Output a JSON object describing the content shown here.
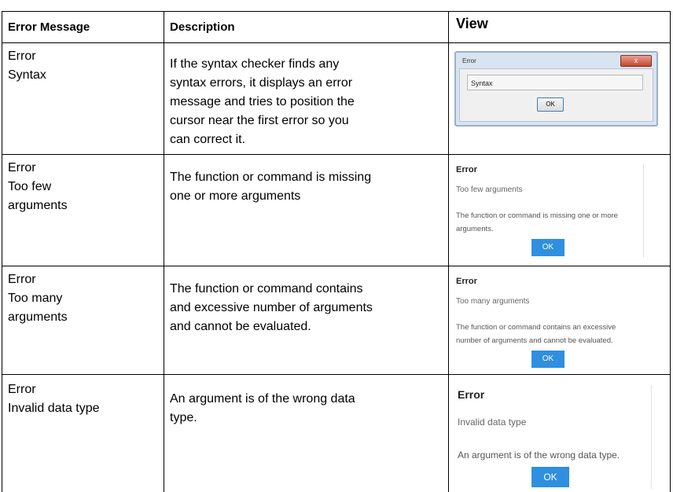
{
  "headers": {
    "col1": "Error Message",
    "col2": "Description",
    "col3": "View"
  },
  "rows": [
    {
      "message_line1": "Error",
      "message_line2": "Syntax",
      "description": "If the syntax checker finds any\nsyntax errors, it displays an error\nmessage and tries to position the\ncursor near the first error so you\ncan correct it.",
      "view": {
        "title": "Error",
        "close": "x",
        "field": "Syntax",
        "ok": "OK"
      }
    },
    {
      "message_line1": "Error",
      "message_line2": "Too few\narguments",
      "description": "The function or command is missing\none or more arguments",
      "view": {
        "title": "Error",
        "subtitle": "Too few arguments",
        "text": "The function or command is missing one or more\narguments.",
        "ok": "OK"
      }
    },
    {
      "message_line1": "Error",
      "message_line2": "Too many\narguments",
      "description": "The function or command contains\nand excessive number of arguments\nand cannot be evaluated.",
      "view": {
        "title": "Error",
        "subtitle": "Too many arguments",
        "text": "The function or command contains an excessive\nnumber of arguments and cannot be evaluated.",
        "ok": "OK"
      }
    },
    {
      "message_line1": "Error",
      "message_line2": "Invalid data type",
      "description": "An argument is of the wrong data\ntype.",
      "view": {
        "title": "Error",
        "subtitle": "Invalid data type",
        "text": "An argument is of the wrong data type.",
        "ok": "OK"
      }
    }
  ],
  "colors": {
    "ok_button": "#2f8fe0",
    "dialog_border": "#9ab0c8"
  }
}
